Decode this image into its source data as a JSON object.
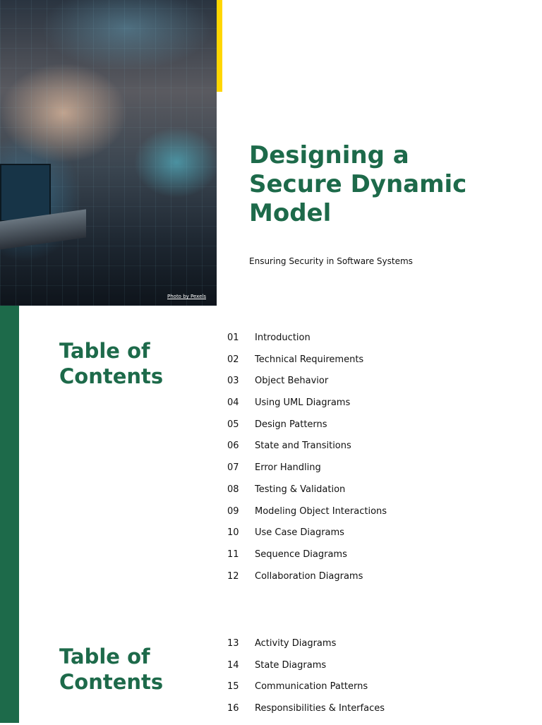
{
  "hero": {
    "credit": "Photo by Pexels"
  },
  "title": "Designing a Secure Dynamic Model",
  "subtitle": "Ensuring Security in Software Systems",
  "toc": [
    {
      "heading": "Table of Contents",
      "items": [
        {
          "num": "01",
          "label": "Introduction"
        },
        {
          "num": "02",
          "label": "Technical Requirements"
        },
        {
          "num": "03",
          "label": "Object Behavior"
        },
        {
          "num": "04",
          "label": "Using UML Diagrams"
        },
        {
          "num": "05",
          "label": "Design Patterns"
        },
        {
          "num": "06",
          "label": "State and Transitions"
        },
        {
          "num": "07",
          "label": "Error Handling"
        },
        {
          "num": "08",
          "label": "Testing & Validation"
        },
        {
          "num": "09",
          "label": "Modeling Object Interactions"
        },
        {
          "num": "10",
          "label": "Use Case Diagrams"
        },
        {
          "num": "11",
          "label": "Sequence Diagrams"
        },
        {
          "num": "12",
          "label": "Collaboration Diagrams"
        }
      ]
    },
    {
      "heading": "Table of Contents",
      "items": [
        {
          "num": "13",
          "label": "Activity Diagrams"
        },
        {
          "num": "14",
          "label": "State Diagrams"
        },
        {
          "num": "15",
          "label": "Communication Patterns"
        },
        {
          "num": "16",
          "label": "Responsibilities & Interfaces"
        }
      ]
    }
  ],
  "colors": {
    "accent": "#1d6a4a",
    "highlight": "#ffd600"
  }
}
